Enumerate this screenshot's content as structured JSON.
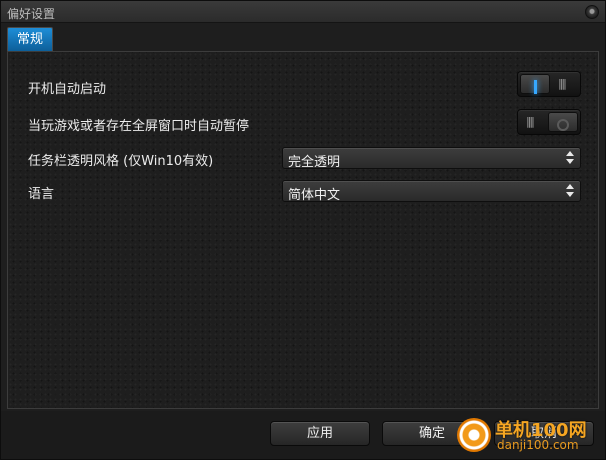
{
  "window": {
    "title": "偏好设置"
  },
  "tabs": [
    {
      "label": "常规",
      "active": true
    }
  ],
  "settings": {
    "autostart": {
      "label": "开机自动启动",
      "enabled": true
    },
    "autopause": {
      "label": "当玩游戏或者存在全屏窗口时自动暂停",
      "enabled": false
    },
    "taskbar_style": {
      "label": "任务栏透明风格 (仅Win10有效)",
      "value": "完全透明"
    },
    "language": {
      "label": "语言",
      "value": "简体中文"
    }
  },
  "footer": {
    "apply_label": "应用",
    "ok_label": "确定",
    "cancel_label": "取消"
  },
  "watermark": {
    "name": "单机100网",
    "url": "danji100.com"
  },
  "colors": {
    "accent": "#1a8ad4",
    "toggle_on": "#36a8ff",
    "background": "#1e1e1e"
  }
}
